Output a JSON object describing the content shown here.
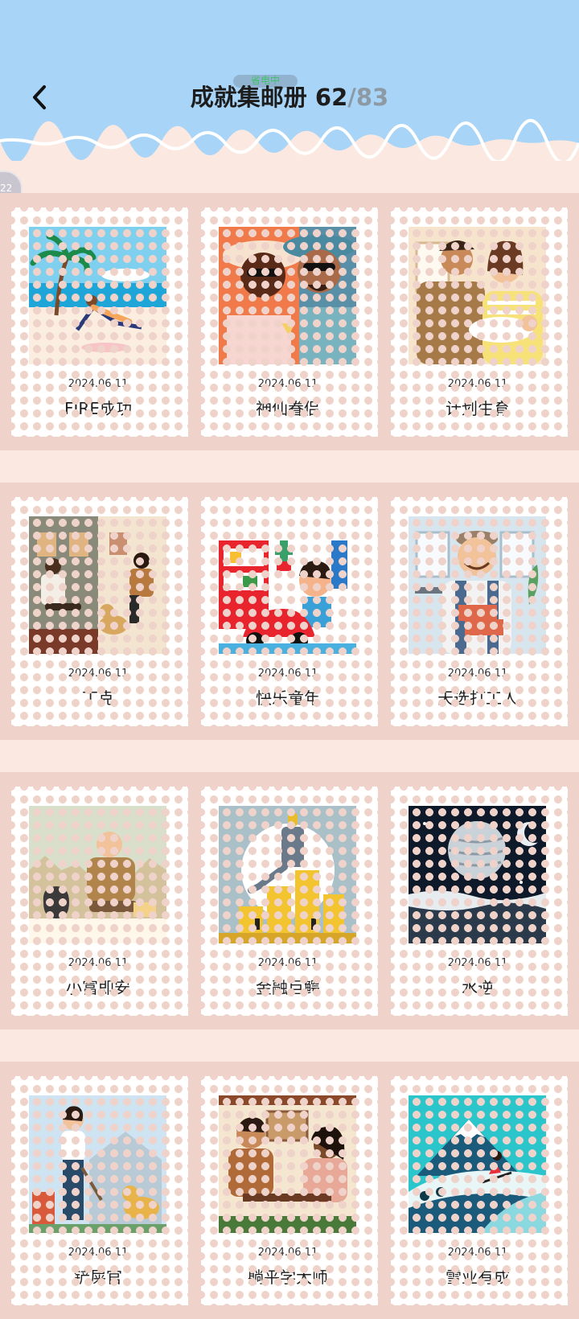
{
  "header": {
    "title": "成就集邮册",
    "collected": "62",
    "separator": "/",
    "total": "83",
    "status_chip": "省电中",
    "side_badge": "22"
  },
  "colors": {
    "header_sky": "#a8d4f7",
    "page_bg": "#fbe9e1",
    "band_bg": "#efd2c9",
    "stamp_bg": "#ffffff"
  },
  "stamps": [
    {
      "date": "2024.06.11",
      "name": "FIRE成功",
      "icon": "beach-chill-illustration"
    },
    {
      "date": "2024.06.11",
      "name": "神仙眷侣",
      "icon": "couple-selfie-illustration"
    },
    {
      "date": "2024.06.11",
      "name": "计划生育",
      "icon": "parents-baby-illustration"
    },
    {
      "date": "2024.06.11",
      "name": "丁克",
      "icon": "couple-with-dog-illustration"
    },
    {
      "date": "2024.06.11",
      "name": "快乐童年",
      "icon": "kid-toy-car-illustration"
    },
    {
      "date": "2024.06.11",
      "name": "天选打工人",
      "icon": "worker-bricks-illustration"
    },
    {
      "date": "2024.06.11",
      "name": "小富即安",
      "icon": "man-money-bag-illustration"
    },
    {
      "date": "2024.06.11",
      "name": "金融巨鳄",
      "icon": "tycoon-on-coins-illustration"
    },
    {
      "date": "2024.06.11",
      "name": "水逆",
      "icon": "planets-night-illustration"
    },
    {
      "date": "2024.06.11",
      "name": "铲屎官",
      "icon": "dog-walker-illustration"
    },
    {
      "date": "2024.06.11",
      "name": "躺平学大师",
      "icon": "cafe-chat-illustration"
    },
    {
      "date": "2024.06.11",
      "name": "雪业有成",
      "icon": "skier-mountain-illustration"
    }
  ]
}
